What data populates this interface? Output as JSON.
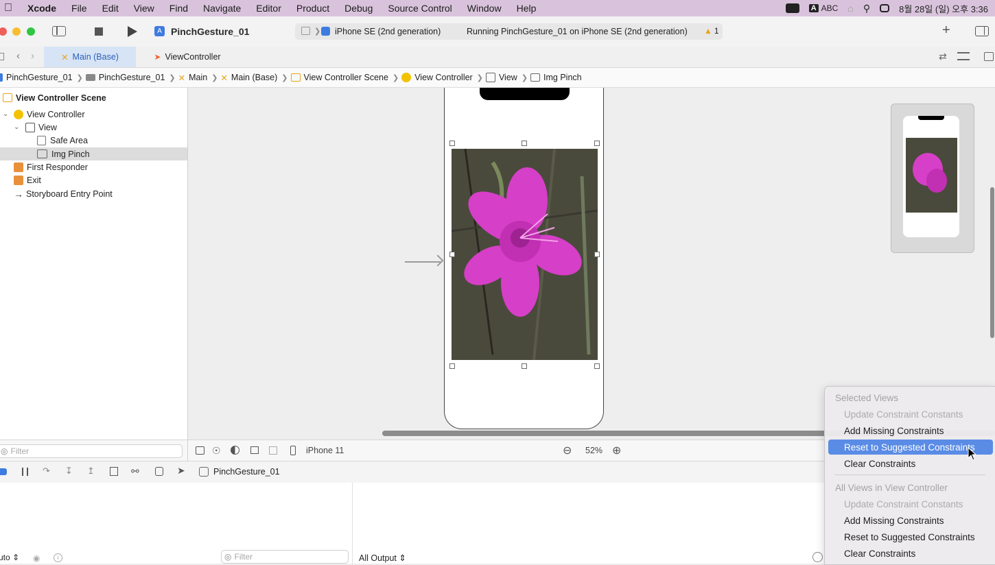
{
  "menubar": {
    "items": [
      "Xcode",
      "File",
      "Edit",
      "View",
      "Find",
      "Navigate",
      "Editor",
      "Product",
      "Debug",
      "Source Control",
      "Window",
      "Help"
    ],
    "input_source_letter": "A",
    "input_source": "ABC",
    "datetime": "8월 28일 (일) 오후 3:36"
  },
  "toolbar": {
    "scheme_name": "PinchGesture_01",
    "device": "iPhone SE (2nd generation)",
    "status": "Running PinchGesture_01 on iPhone SE (2nd generation)",
    "warning_count": "1"
  },
  "tabs": [
    {
      "label": "Main (Base)",
      "active": true
    },
    {
      "label": "ViewController",
      "active": false
    }
  ],
  "breadcrumb": [
    "PinchGesture_01",
    "PinchGesture_01",
    "Main",
    "Main (Base)",
    "View Controller Scene",
    "View Controller",
    "View",
    "Img Pinch"
  ],
  "outline": {
    "scene_title": "View Controller Scene",
    "items": [
      {
        "label": "View Controller",
        "level": 1
      },
      {
        "label": "View",
        "level": 2
      },
      {
        "label": "Safe Area",
        "level": 3
      },
      {
        "label": "Img Pinch",
        "level": 3,
        "selected": true
      },
      {
        "label": "First Responder",
        "level": 1
      },
      {
        "label": "Exit",
        "level": 1
      },
      {
        "label": "Storyboard Entry Point",
        "level": 1
      }
    ],
    "filter_placeholder": "Filter"
  },
  "canvas_bar": {
    "device_label": "iPhone 11",
    "zoom": "52%"
  },
  "debug_bar": {
    "target": "PinchGesture_01"
  },
  "console": {
    "auto_label": "uto",
    "filter_placeholder": "Filter",
    "output_label": "All Output"
  },
  "popup_menu": {
    "section1_header": "Selected Views",
    "section1_items": [
      {
        "label": "Update Constraint Constants",
        "disabled": true
      },
      {
        "label": "Add Missing Constraints",
        "disabled": false
      },
      {
        "label": "Reset to Suggested Constraints",
        "highlighted": true
      },
      {
        "label": "Clear Constraints",
        "disabled": false
      }
    ],
    "section2_header": "All Views in View Controller",
    "section2_items": [
      {
        "label": "Update Constraint Constants",
        "disabled": true
      },
      {
        "label": "Add Missing Constraints",
        "disabled": false
      },
      {
        "label": "Reset to Suggested Constraints",
        "disabled": false
      },
      {
        "label": "Clear Constraints",
        "disabled": false
      }
    ]
  },
  "colors": {
    "menubar_bg": "#d9c3dc",
    "active_tab_bg": "#d7e4f6",
    "selection_blue": "#5a8ce6",
    "flower_pink": "#d63fc7",
    "warning_yellow": "#e8a317"
  }
}
